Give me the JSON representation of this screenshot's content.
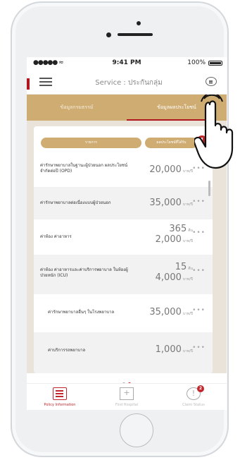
{
  "status_bar": {
    "signal": "●●●●● ≈",
    "time": "9:41 PM",
    "battery": "100%"
  },
  "navbar": {
    "title": "Service : ประกันกลุ่ม"
  },
  "tabs": [
    {
      "label": "ข้อมูลกรมธรรม์"
    },
    {
      "label": "ข้อมูลผลประโยชน์"
    }
  ],
  "table_header": {
    "col1": "รายการ",
    "col2": "ผลประโยชน์ที่ได้รับ"
  },
  "info_button": "!",
  "rows": [
    {
      "name": "ค่ารักษาพยาบาลในฐานะผู้ป่วยนอก ผลประโยชน์จำกัดต่อปี (OPD)",
      "amount": "20,000",
      "unit": "บาท/ปี",
      "more": "•••"
    },
    {
      "name": "ค่ารักษาพยาบาลต่อเนื่องแบบผู้ป่วยนอก",
      "amount": "35,000",
      "unit": "บาท/ปี",
      "more": "•••"
    },
    {
      "name": "ค่าห้อง ค่าอาหาร",
      "amount": "365",
      "unit": "คืน",
      "amount2": "2,000",
      "unit2": "บาท/ปี",
      "more": "•••"
    },
    {
      "name": "ค่าห้อง ค่าอาหารและค่าบริการพยาบาล ในห้องผู้ป่วยหนัก (ICU)",
      "amount": "15",
      "unit": "คืน",
      "amount2": "4,000",
      "unit2": "บาท/ปี",
      "more": "•••"
    },
    {
      "name": "ค่ารักษาพยาบาลอื่นๆ ในโรงพยาบาล",
      "amount": "35,000",
      "unit": "บาท/ปี",
      "more": "•••"
    },
    {
      "name": "ค่าบริการรถพยาบาล",
      "amount": "1,000",
      "unit": "บาท/ปี",
      "more": "•••"
    }
  ],
  "bottom_nav": [
    {
      "label": "Policy Information",
      "icon": "policy-icon"
    },
    {
      "label": "Find Hospital",
      "icon": "hospital-icon"
    },
    {
      "label": "Claim Status",
      "icon": "claim-icon",
      "badge": "2"
    }
  ],
  "colors": {
    "accent_gold": "#cfac72",
    "brand_red": "#c0282d"
  }
}
